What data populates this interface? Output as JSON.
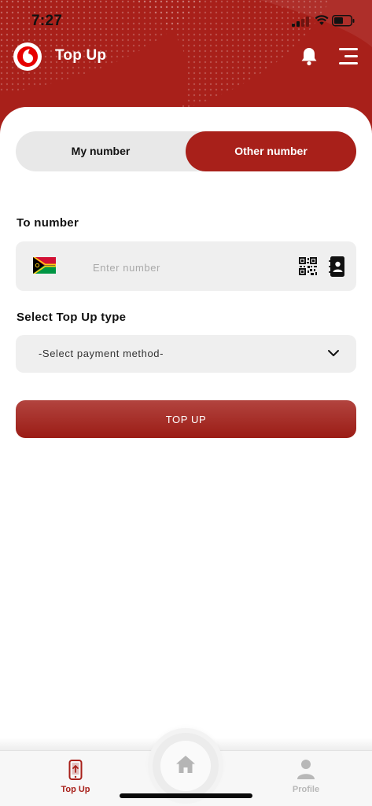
{
  "status_bar": {
    "time": "7:27"
  },
  "header": {
    "title": "Top Up",
    "logo_icon": "vodafone-logo",
    "notification_icon": "bell-icon",
    "menu_icon": "hamburger-menu-icon"
  },
  "number_toggle": {
    "my_number": "My number",
    "other_number": "Other number",
    "selected": "Other number"
  },
  "to_number": {
    "label": "To number",
    "placeholder": "Enter number",
    "value": "",
    "flag_icon": "vanuatu-flag-icon",
    "qr_icon": "qr-code-icon",
    "contacts_icon": "contact-book-icon"
  },
  "topup_type": {
    "label": "Select Top Up type",
    "selected": "-Select payment method-",
    "dropdown_icon": "chevron-down-icon"
  },
  "submit": {
    "label": "TOP UP"
  },
  "tab_bar": {
    "active": "Top Up",
    "tabs": [
      {
        "label": "Top Up",
        "icon": "phone-topup-icon"
      },
      {
        "label": "",
        "icon": "home-icon"
      },
      {
        "label": "Profile",
        "icon": "person-icon"
      }
    ]
  },
  "colors": {
    "brand": "#a8201a",
    "field_bg": "#efefef",
    "inactive_tab": "#b8b8b8"
  }
}
